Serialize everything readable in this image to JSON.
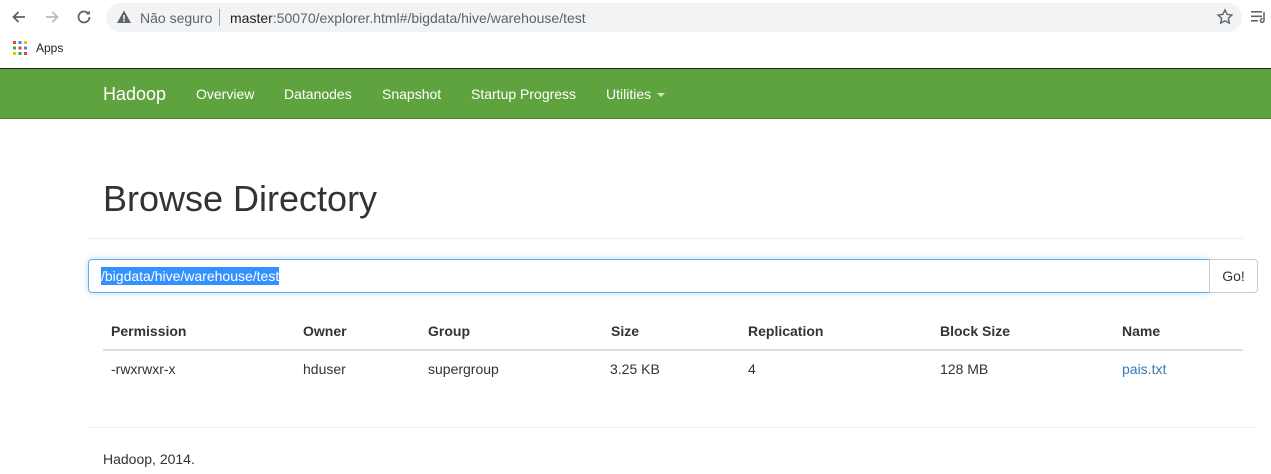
{
  "browser": {
    "security_label": "Não seguro",
    "url_host": "master",
    "url_rest": ":50070/explorer.html#/bigdata/hive/warehouse/test",
    "bookmarks": {
      "apps_label": "Apps"
    }
  },
  "navbar": {
    "brand": "Hadoop",
    "links": [
      "Overview",
      "Datanodes",
      "Snapshot",
      "Startup Progress",
      "Utilities"
    ]
  },
  "page": {
    "title": "Browse Directory",
    "path_value": "/bigdata/hive/warehouse/test",
    "go_label": "Go!"
  },
  "table": {
    "columns": [
      "Permission",
      "Owner",
      "Group",
      "Size",
      "Replication",
      "Block Size",
      "Name"
    ],
    "rows": [
      [
        "-rwxrwxr-x",
        "hduser",
        "supergroup",
        "3.25 KB",
        "4",
        "128 MB",
        "pais.txt"
      ]
    ]
  },
  "footer": {
    "text": "Hadoop, 2014."
  },
  "colors": {
    "navbar": "#5fa33e",
    "link": "#337ab7",
    "selection": "#3390ff"
  }
}
